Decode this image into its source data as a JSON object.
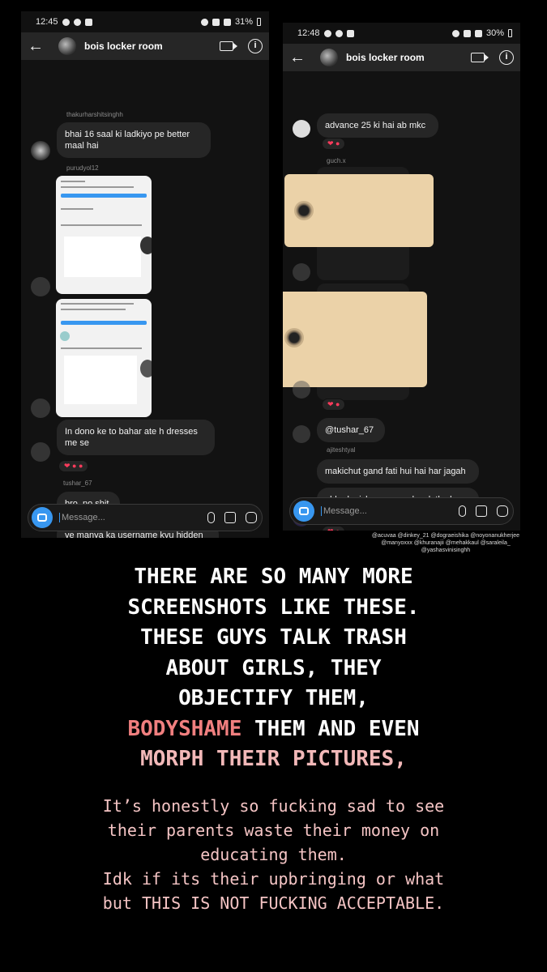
{
  "left_phone": {
    "status": {
      "time": "12:45",
      "battery": "31%"
    },
    "header": {
      "title": "bois locker room"
    },
    "messages": {
      "user1": "thakurharshitsinghh",
      "msg1": "bhai 16 saal ki ladkiyo pe better maal hai",
      "user2": "purudyol12",
      "msg2": "In dono ke to bahar ate h dresses me se",
      "user3": "tushar_67",
      "msg3": "bro, no shit",
      "msg4": "ye manya ka username kyu hidden haii?"
    },
    "composer": {
      "placeholder": "Message..."
    }
  },
  "right_phone": {
    "status": {
      "time": "12:48",
      "battery": "30%"
    },
    "header": {
      "title": "bois locker room"
    },
    "messages": {
      "msg1": "advance 25 ki hai ab mkc",
      "user1": "guch.x",
      "msg2": "@tushar_67",
      "user2": "ajiteshtyal",
      "msg3": "makichut gand fati hui hai har jagah",
      "msg4": "abbe bc iske mamme kya latke hue hai"
    },
    "composer": {
      "placeholder": "Message..."
    }
  },
  "mentions": "@acuvaa @dinkey_21 @dograeishika @noyonanukherjee @manyoxxx @khuranajii @mehakkaul @saraleila_ @yashasvinisinghh",
  "caption": {
    "line1": "THERE ARE SO MANY MORE",
    "line2": "SCREENSHOTS LIKE THESE.",
    "line3": "THESE GUYS TALK TRASH",
    "line4": "ABOUT GIRLS, THEY",
    "line5": "OBJECTIFY THEM,",
    "line6_highlight": "BODYSHAME",
    "line6_rest": "THEM AND EVEN",
    "line7": "MORPH THEIR PICTURES,"
  },
  "subcaption": {
    "line1": "It’s honestly so fucking sad to see",
    "line2": "their parents waste their money on",
    "line3": "educating them.",
    "line4": "Idk if its their upbringing or what",
    "line5": "but THIS IS NOT FUCKING ACCEPTABLE."
  },
  "colors": {
    "caption_pink": "#f2b8b8",
    "highlight": "#f07f7f",
    "ig_blue": "#3897f0"
  }
}
